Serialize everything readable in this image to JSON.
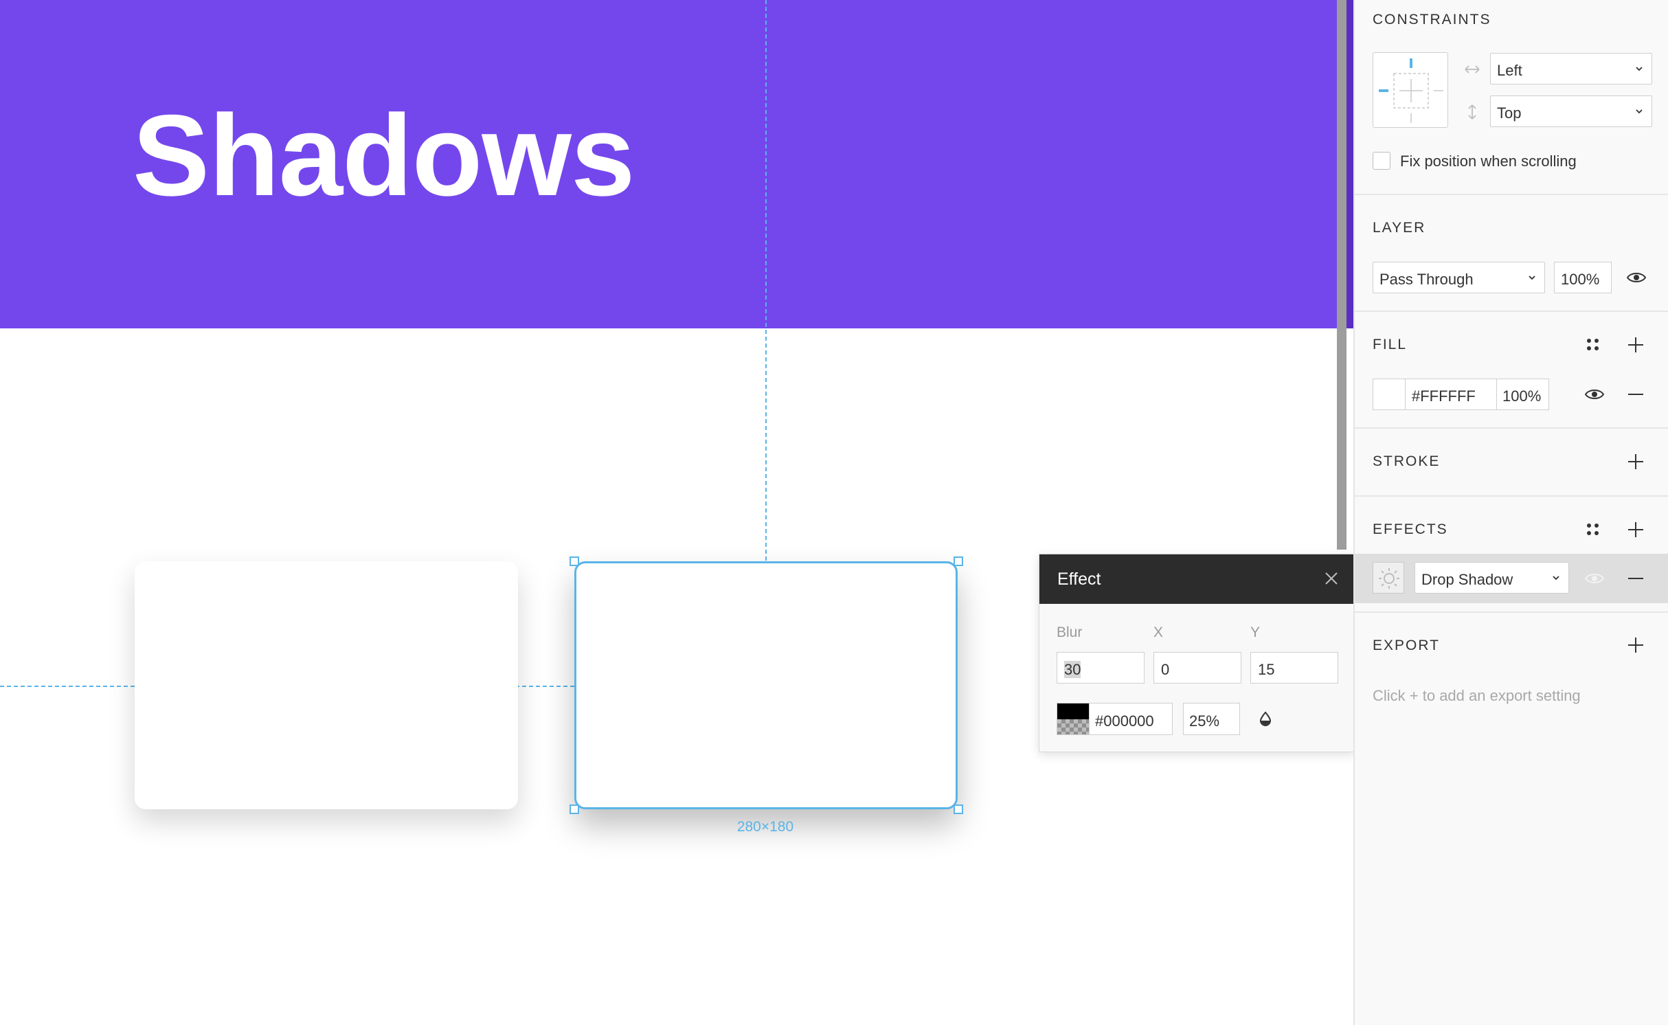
{
  "canvas": {
    "hero_title": "Shadows",
    "hero_color": "#7447ed",
    "selection_color": "#5ab4e8",
    "selected_dimensions": "280×180"
  },
  "effect_popup": {
    "title": "Effect",
    "blur_label": "Blur",
    "x_label": "X",
    "y_label": "Y",
    "blur_value": "30",
    "x_value": "0",
    "y_value": "15",
    "color_hex": "#000000",
    "opacity": "25%",
    "close_icon": "close-icon",
    "drop_icon": "drop-icon"
  },
  "panel": {
    "constraints": {
      "title": "CONSTRAINTS",
      "horizontal": "Left",
      "vertical": "Top",
      "fix_position_label": "Fix position when scrolling",
      "fix_position_checked": false
    },
    "layer": {
      "title": "LAYER",
      "blend_mode": "Pass Through",
      "opacity": "100%"
    },
    "fill": {
      "title": "FILL",
      "color_hex": "#FFFFFF",
      "opacity": "100%"
    },
    "stroke": {
      "title": "STROKE"
    },
    "effects": {
      "title": "EFFECTS",
      "type": "Drop Shadow"
    },
    "export": {
      "title": "EXPORT",
      "hint": "Click + to add an export setting"
    }
  }
}
